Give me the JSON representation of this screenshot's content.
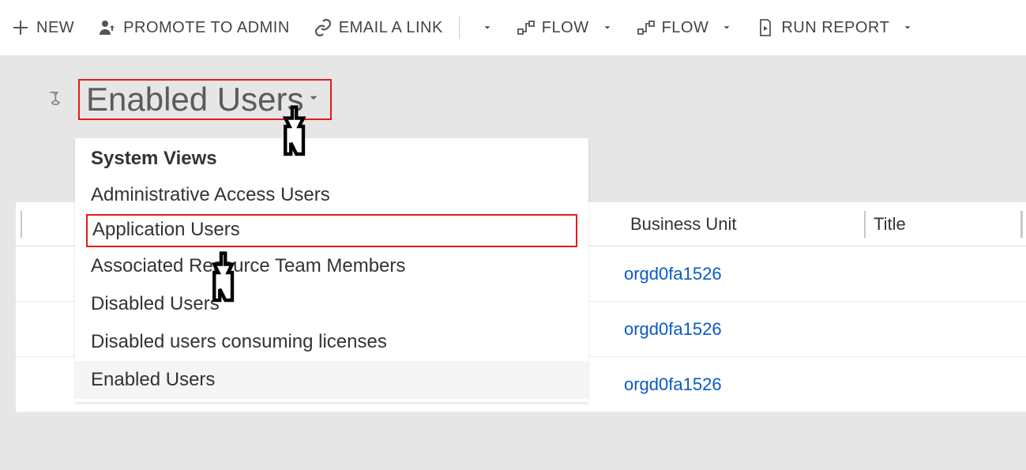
{
  "commands": {
    "new": "NEW",
    "promote": "PROMOTE TO ADMIN",
    "email": "EMAIL A LINK",
    "flow1": "FLOW",
    "flow2": "FLOW",
    "run": "RUN REPORT"
  },
  "view": {
    "title": "Enabled Users"
  },
  "dropdown": {
    "header": "System Views",
    "items": [
      "Administrative Access Users",
      "Application Users",
      "Associated Resource Team Members",
      "Disabled Users",
      "Disabled users consuming licenses",
      "Enabled Users"
    ],
    "highlight_index": 1,
    "selected_index": 5
  },
  "grid": {
    "columns": {
      "bu": "Business Unit",
      "title": "Title"
    },
    "rows": [
      {
        "bu": "orgd0fa1526"
      },
      {
        "bu": "orgd0fa1526"
      },
      {
        "bu": "orgd0fa1526"
      }
    ]
  }
}
